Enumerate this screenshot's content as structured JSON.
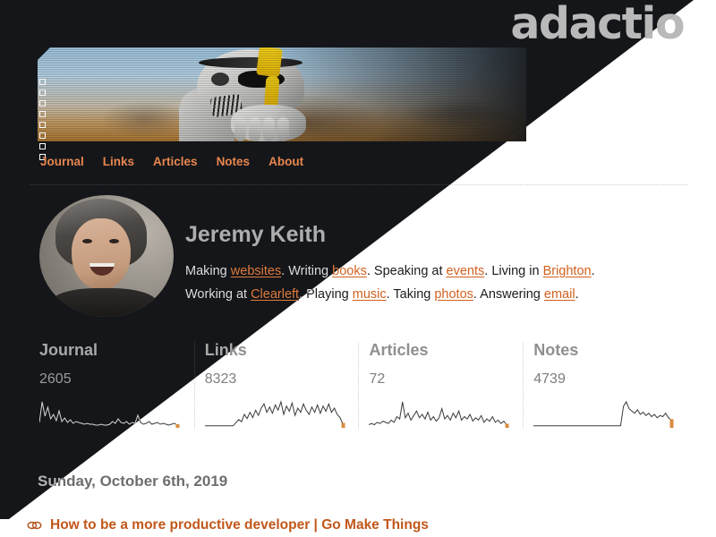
{
  "site": {
    "logo": "adactio",
    "theme_light_bg": "#ffffff",
    "theme_dark_bg": "#141619",
    "accent_dark": "#e8864f",
    "accent_light": "#d2601f"
  },
  "banner": {
    "alt": "stormtrooper-banner",
    "swatch_count": 8
  },
  "nav": {
    "items": [
      {
        "label": "Journal",
        "name": "nav-journal"
      },
      {
        "label": "Links",
        "name": "nav-links"
      },
      {
        "label": "Articles",
        "name": "nav-articles"
      },
      {
        "label": "Notes",
        "name": "nav-notes"
      },
      {
        "label": "About",
        "name": "nav-about"
      }
    ]
  },
  "profile": {
    "name": "Jeremy Keith",
    "avatar_alt": "jeremy-keith-avatar",
    "bio_line1": [
      {
        "text": "Making "
      },
      {
        "text": "websites",
        "link": true
      },
      {
        "text": ". Writing "
      },
      {
        "text": "books",
        "link": true
      },
      {
        "text": ". Speaking at "
      },
      {
        "text": "events",
        "link": true
      },
      {
        "text": ". Living in "
      },
      {
        "text": "Brighton",
        "link": true
      },
      {
        "text": "."
      }
    ],
    "bio_line2": [
      {
        "text": "Working at "
      },
      {
        "text": "Clearleft",
        "link": true
      },
      {
        "text": ". Playing "
      },
      {
        "text": "music",
        "link": true
      },
      {
        "text": ". Taking "
      },
      {
        "text": "photos",
        "link": true
      },
      {
        "text": ". Answering "
      },
      {
        "text": "email",
        "link": true
      },
      {
        "text": "."
      }
    ]
  },
  "stats": [
    {
      "label": "Journal",
      "count": "2605",
      "sparkline": [
        5,
        28,
        12,
        22,
        9,
        14,
        7,
        18,
        6,
        10,
        5,
        8,
        4,
        6,
        5,
        4,
        3,
        4,
        3,
        3,
        2,
        2,
        3,
        2,
        2,
        3,
        6,
        4,
        9,
        5,
        4,
        6,
        3,
        5,
        4,
        13,
        5,
        3,
        4,
        6,
        3,
        4,
        5,
        3,
        4,
        3,
        2,
        3,
        4,
        2
      ]
    },
    {
      "label": "Links",
      "count": "8323",
      "sparkline": [
        1,
        1,
        1,
        1,
        1,
        1,
        1,
        1,
        1,
        1,
        1,
        4,
        7,
        5,
        12,
        8,
        14,
        9,
        16,
        11,
        18,
        22,
        14,
        19,
        13,
        21,
        16,
        24,
        12,
        20,
        15,
        23,
        11,
        18,
        14,
        22,
        16,
        12,
        19,
        14,
        21,
        13,
        20,
        15,
        22,
        14,
        18,
        12,
        9,
        3
      ]
    },
    {
      "label": "Articles",
      "count": "72",
      "sparkline": [
        2,
        3,
        2,
        4,
        3,
        5,
        4,
        3,
        6,
        4,
        9,
        7,
        22,
        8,
        12,
        6,
        10,
        14,
        8,
        11,
        7,
        13,
        6,
        9,
        5,
        8,
        16,
        7,
        10,
        6,
        12,
        8,
        14,
        6,
        9,
        7,
        11,
        5,
        8,
        6,
        10,
        4,
        7,
        5,
        9,
        4,
        6,
        3,
        5,
        2
      ]
    },
    {
      "label": "Notes",
      "count": "4739",
      "sparkline": [
        1,
        1,
        1,
        1,
        1,
        1,
        1,
        1,
        1,
        1,
        1,
        1,
        1,
        1,
        1,
        1,
        1,
        1,
        1,
        1,
        1,
        1,
        1,
        1,
        1,
        1,
        1,
        1,
        1,
        1,
        1,
        1,
        18,
        22,
        16,
        14,
        12,
        15,
        11,
        13,
        10,
        12,
        9,
        11,
        8,
        10,
        9,
        12,
        8,
        6
      ]
    }
  ],
  "feed": {
    "date": "Sunday, October 6th, 2019",
    "entry_title": "How to be a more productive developer | Go Make Things",
    "entry_icon": "link-icon"
  }
}
